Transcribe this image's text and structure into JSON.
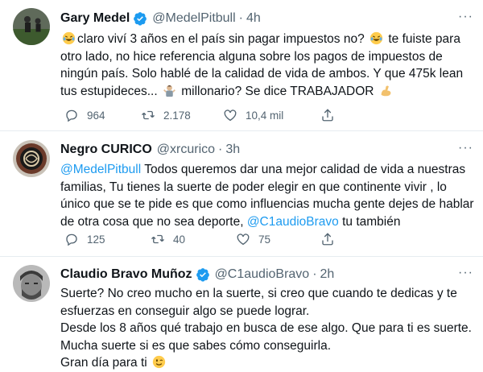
{
  "colors": {
    "accent": "#1d9bf0",
    "muted": "#536471",
    "text": "#0f1419",
    "verified": "#1d9bf0"
  },
  "tweets": [
    {
      "name": "Gary Medel",
      "handle": "@MedelPitbull",
      "dot": "·",
      "time": "4h",
      "more": "···",
      "text": {
        "p1": "claro viví 3 años en el país sin pagar impuestos no?",
        "p2": "te fuiste para otro lado, no hice referencia alguna sobre los pagos de impuestos de ningún país. Solo hablé de la calidad de vida de ambos. Y que 475k lean tus estupideces...",
        "p3": "millonario? Se dice TRABAJADOR"
      },
      "stats": {
        "replies": "964",
        "retweets": "2.178",
        "likes": "10,4 mil"
      }
    },
    {
      "name": "Negro CURICO",
      "handle": "@xrcurico",
      "dot": "·",
      "time": "3h",
      "more": "···",
      "text": {
        "mention1": "@MedelPitbull",
        "p1": "Todos queremos dar una mejor calidad de vida a nuestras familias, Tu tienes la suerte de poder elegir en que continente vivir , lo único que se te pide es que como influencias mucha gente dejes de hablar de otra cosa que no sea deporte,",
        "mention2": "@C1audioBravo",
        "p2": "tu también"
      },
      "stats": {
        "replies": "125",
        "retweets": "40",
        "likes": "75"
      }
    },
    {
      "name": "Claudio Bravo Muñoz",
      "handle": "@C1audioBravo",
      "dot": "·",
      "time": "2h",
      "more": "···",
      "text": {
        "l1": "Suerte? No creo mucho en la suerte, si creo que cuando te dedicas y te esfuerzas en conseguir algo se puede lograr.",
        "l2": "Desde los 8 años qué trabajo en busca de ese algo. Que para ti es suerte. Mucha suerte si es que sabes cómo conseguirla.",
        "l3": "Gran día para ti"
      }
    }
  ]
}
